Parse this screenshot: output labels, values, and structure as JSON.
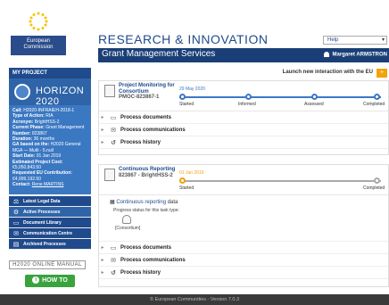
{
  "header": {
    "logo_text_line1": "European",
    "logo_text_line2": "Commission",
    "title": "RESEARCH & INNOVATION",
    "help_select": "Help",
    "subtitle": "Grant Management Services",
    "user": "Margaret ARMSTRON"
  },
  "sidebar": {
    "section_title": "MY PROJECT",
    "banner": "HORIZON 2020",
    "info": [
      {
        "k": "Call:",
        "v": "H2020-INFRAIEH-2018-1"
      },
      {
        "k": "Type of Action:",
        "v": "RIA"
      },
      {
        "k": "Acronym:",
        "v": "BrightHSS-2"
      },
      {
        "k": "Current Phase:",
        "v": "Grant Management"
      },
      {
        "k": "Number:",
        "v": "823867"
      },
      {
        "k": "Duration:",
        "v": "36 months"
      },
      {
        "k": "GA based on the:",
        "v": "H2020 General MGA — Multi - 5.null"
      },
      {
        "k": "Start Date:",
        "v": "01 Jan 2019"
      },
      {
        "k": "Estimated Project Cost:",
        "v": "€5,050,843.50"
      },
      {
        "k": "Requested EU Contribution:",
        "v": "€4,999,192.50"
      },
      {
        "k": "Contact:",
        "v": "Rene MARTINS"
      }
    ],
    "menu": [
      {
        "label": "Latest Legal Data",
        "icon": "scale-icon"
      },
      {
        "label": "Active Processes",
        "icon": "gear-icon"
      },
      {
        "label": "Document Library",
        "icon": "folder-icon"
      },
      {
        "label": "Communication Centre",
        "icon": "chat-icon"
      },
      {
        "label": "Archived Processes",
        "icon": "archive-icon"
      }
    ],
    "manual": "H2020 ONLINE MANUAL",
    "howto": "HOW TO"
  },
  "main": {
    "launch_text": "Launch new interaction with the EU",
    "launch_plus": "+",
    "card1": {
      "title": "Project Monitoring for Consortium",
      "sub": "PMOC-823867-1",
      "date": "29 May 2020",
      "steps": [
        "Started",
        "Informed",
        "Assessed",
        "Completed"
      ],
      "rows": [
        "Process documents",
        "Process communications",
        "Process history"
      ]
    },
    "card2": {
      "title": "Continuous Reporting",
      "sub": "823867 - BrightHSS-2",
      "date": "01 Jan 2019",
      "steps": [
        "Started",
        "Completed"
      ],
      "body_link": "Continuous reporting",
      "body_suffix": "data",
      "body_status": "Progress status for this task type:",
      "body_tag": "[Consortium]",
      "rows": [
        "Process documents",
        "Process communications",
        "Process history"
      ]
    }
  },
  "footer": "© European Communities - Version 7.0.3",
  "colors": {
    "primary": "#1f4a8c",
    "accent": "#3b78c2",
    "warning": "#f0a30a",
    "success": "#3aa33d"
  }
}
